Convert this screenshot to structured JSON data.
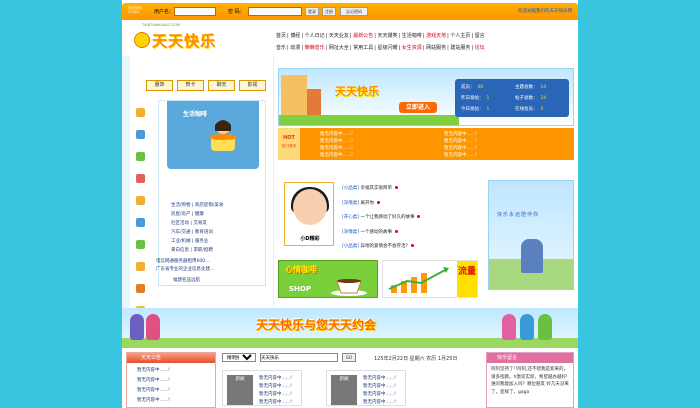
{
  "topbar": {
    "mini_logo": "天天快乐 LOGIN",
    "username_label": "用户名：",
    "password_label": "密 码：",
    "login_button": "登录",
    "register_button": "注册",
    "forgot_button": "忘记密码",
    "notice": "欢迎光临我们的天天快乐网"
  },
  "header": {
    "logo_url": "TIANTIANKUAILE.COM",
    "logo_name": "天天快乐",
    "nav_row1": [
      "首页",
      "博经",
      "个人日记",
      "天天业友",
      "最新公告",
      "天天爆笑",
      "生活咖啡",
      "游戏天地",
      "个人主页",
      "留言"
    ],
    "nav_row2": [
      "音乐",
      "动漫",
      "懒懒音乐",
      "网址大全",
      "常用工具",
      "星级闪耀",
      "女生资源",
      "网站服务",
      "建站服务",
      "论坛"
    ]
  },
  "left": {
    "tabs": [
      "服饰",
      "贺卡",
      "聊天",
      "影视"
    ],
    "panel_title": "生活咖啡",
    "links": [
      "生活/购物 | 商店促销/美食",
      "房屋/房产 | 健康",
      "社区活动 | 交易友",
      "汽车/交通 | 教育培训",
      "工业/机械 | 服务业",
      "黄白信息 | 求职/招聘"
    ],
    "panel_bottom": "福建名品远航",
    "foot": [
      "电信网通服务器租用600...",
      "广东省专业的企业信息化建..."
    ]
  },
  "banner": {
    "name": "天天快乐",
    "enter_button": "立即进入",
    "stats": [
      {
        "label": "成员：",
        "value": "46"
      },
      {
        "label": "主题总数：",
        "value": "14"
      },
      {
        "label": "昨日发帖：",
        "value": "1"
      },
      {
        "label": "帖子总数：",
        "value": "24"
      },
      {
        "label": "今日发帖：",
        "value": "1"
      },
      {
        "label": "在线会员：",
        "value": "0"
      }
    ]
  },
  "hot": {
    "badge": "HOT",
    "badge_sub": "热门资讯",
    "items": [
      "暂无内容中......!",
      "暂无内容中......!",
      "暂无内容中......!",
      "暂无内容中......!",
      "暂无内容中......!",
      "暂无内容中......!",
      "暂无内容中......!",
      "暂无内容中......!"
    ]
  },
  "stories": {
    "photo_caption": "小D精彩",
    "list": [
      {
        "tag": "[小品类]",
        "text": "幸福其实很简单"
      },
      {
        "tag": "[深情类]",
        "text": "离开你"
      },
      {
        "tag": "[开心类]",
        "text": "一个让我感动了好久的故事"
      },
      {
        "tag": "[深情类]",
        "text": "一个感动的故事"
      },
      {
        "tag": "[小品类]",
        "text": "异地的爱情会不会存活?"
      }
    ]
  },
  "promos": {
    "cafe_title": "心情咖啡",
    "shop": "SHOP",
    "flow": "流量"
  },
  "ad": {
    "text": "快乐永远陪伴你"
  },
  "strip": {
    "text": "天天快乐与您天天约会"
  },
  "bottom": {
    "left_title": "天天公告",
    "left_items": [
      "暂无内容中......!",
      "暂无内容中......!",
      "暂无内容中......!",
      "暂无内容中......!"
    ],
    "search_select": "精明搜索",
    "search_value": "天天快乐",
    "search_go": "GO",
    "date": "125年2月22日  星期六  农历 1月25日",
    "news_badges": [
      "新闻",
      "新闻"
    ],
    "news_items": [
      "暂无内容中......!",
      "暂无内容中......!",
      "暂无内容中......!",
      "暂无内容中......!",
      "暂无内容中......!",
      "暂无内容中......!",
      "暂无内容中......!",
      "暂无内容中......!"
    ],
    "right_title": "快乐留言",
    "right_text": "阿阿坚持了!!阿阿,还不错我是新来的，请多指教。h激双实际，希望越办越好!谁问我能加入吗？哪位朋友 好几天没来了，变样了，gaga"
  },
  "colors": {
    "background": "#39c5e0",
    "accent": "#ff9600",
    "link": "#1a3a7a"
  }
}
